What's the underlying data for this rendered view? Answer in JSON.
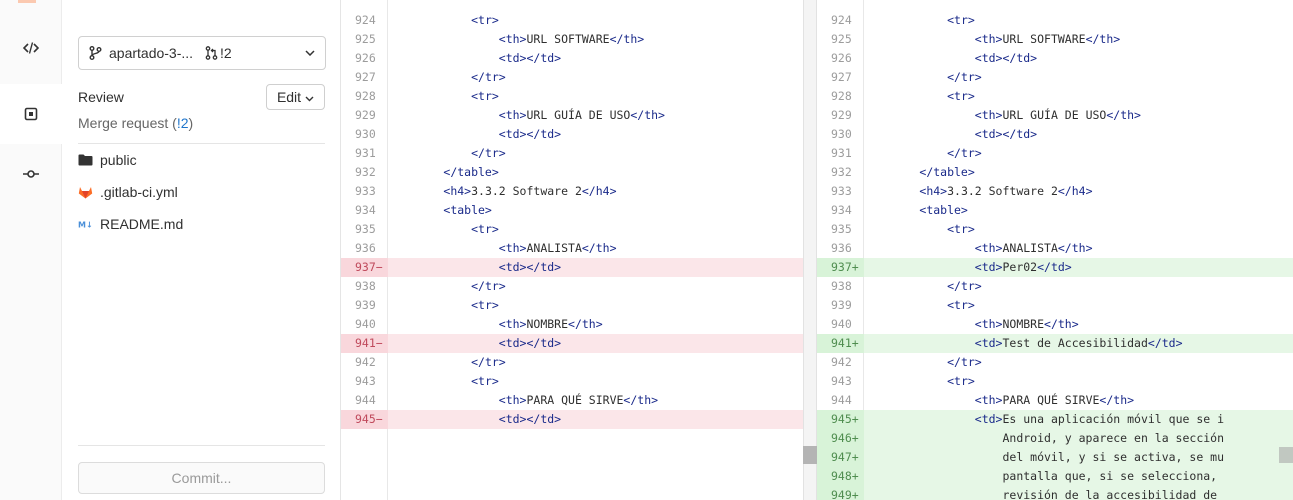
{
  "activity_bar": {
    "items": [
      {
        "icon": "code-icon",
        "active": false
      },
      {
        "icon": "review-icon",
        "active": true
      },
      {
        "icon": "commit-icon",
        "active": false
      }
    ]
  },
  "sidebar": {
    "branch_name": "apartado-3-...",
    "merge_request_badge": "!2",
    "review_title": "Review",
    "edit_label": "Edit",
    "mr_text_prefix": "Merge request (",
    "mr_number": "!2",
    "mr_text_suffix": ")",
    "files": [
      {
        "name": "public",
        "icon": "folder-icon"
      },
      {
        "name": ".gitlab-ci.yml",
        "icon": "gitlab-icon"
      },
      {
        "name": "README.md",
        "icon": "markdown-icon"
      }
    ],
    "commit_label": "Commit..."
  },
  "diff": {
    "left": [
      {
        "n": "924",
        "type": "ctx",
        "code": "            <tr>"
      },
      {
        "n": "925",
        "type": "ctx",
        "code": "                <th>URL SOFTWARE</th>"
      },
      {
        "n": "926",
        "type": "ctx",
        "code": "                <td></td>"
      },
      {
        "n": "927",
        "type": "ctx",
        "code": "            </tr>"
      },
      {
        "n": "928",
        "type": "ctx",
        "code": "            <tr>"
      },
      {
        "n": "929",
        "type": "ctx",
        "code": "                <th>URL GUÍA DE USO</th>"
      },
      {
        "n": "930",
        "type": "ctx",
        "code": "                <td></td>"
      },
      {
        "n": "931",
        "type": "ctx",
        "code": "            </tr>"
      },
      {
        "n": "932",
        "type": "ctx",
        "code": "        </table>"
      },
      {
        "n": "933",
        "type": "ctx",
        "code": "        <h4>3.3.2 Software 2</h4>"
      },
      {
        "n": "934",
        "type": "ctx",
        "code": "        <table>"
      },
      {
        "n": "935",
        "type": "ctx",
        "code": "            <tr>"
      },
      {
        "n": "936",
        "type": "ctx",
        "code": "                <th>ANALISTA</th>"
      },
      {
        "n": "937−",
        "type": "del",
        "code": "                <td></td>"
      },
      {
        "n": "938",
        "type": "ctx",
        "code": "            </tr>"
      },
      {
        "n": "939",
        "type": "ctx",
        "code": "            <tr>"
      },
      {
        "n": "940",
        "type": "ctx",
        "code": "                <th>NOMBRE</th>"
      },
      {
        "n": "941−",
        "type": "del",
        "code": "                <td></td>"
      },
      {
        "n": "942",
        "type": "ctx",
        "code": "            </tr>"
      },
      {
        "n": "943",
        "type": "ctx",
        "code": "            <tr>"
      },
      {
        "n": "944",
        "type": "ctx",
        "code": "                <th>PARA QUÉ SIRVE</th>"
      },
      {
        "n": "945−",
        "type": "del",
        "code": "                <td></td>"
      }
    ],
    "right": [
      {
        "n": "924",
        "type": "ctx",
        "code": "            <tr>"
      },
      {
        "n": "925",
        "type": "ctx",
        "code": "                <th>URL SOFTWARE</th>"
      },
      {
        "n": "926",
        "type": "ctx",
        "code": "                <td></td>"
      },
      {
        "n": "927",
        "type": "ctx",
        "code": "            </tr>"
      },
      {
        "n": "928",
        "type": "ctx",
        "code": "            <tr>"
      },
      {
        "n": "929",
        "type": "ctx",
        "code": "                <th>URL GUÍA DE USO</th>"
      },
      {
        "n": "930",
        "type": "ctx",
        "code": "                <td></td>"
      },
      {
        "n": "931",
        "type": "ctx",
        "code": "            </tr>"
      },
      {
        "n": "932",
        "type": "ctx",
        "code": "        </table>"
      },
      {
        "n": "933",
        "type": "ctx",
        "code": "        <h4>3.3.2 Software 2</h4>"
      },
      {
        "n": "934",
        "type": "ctx",
        "code": "        <table>"
      },
      {
        "n": "935",
        "type": "ctx",
        "code": "            <tr>"
      },
      {
        "n": "936",
        "type": "ctx",
        "code": "                <th>ANALISTA</th>"
      },
      {
        "n": "937+",
        "type": "add",
        "code": "                <td>Per02</td>"
      },
      {
        "n": "938",
        "type": "ctx",
        "code": "            </tr>"
      },
      {
        "n": "939",
        "type": "ctx",
        "code": "            <tr>"
      },
      {
        "n": "940",
        "type": "ctx",
        "code": "                <th>NOMBRE</th>"
      },
      {
        "n": "941+",
        "type": "add",
        "code": "                <td>Test de Accesibilidad</td>"
      },
      {
        "n": "942",
        "type": "ctx",
        "code": "            </tr>"
      },
      {
        "n": "943",
        "type": "ctx",
        "code": "            <tr>"
      },
      {
        "n": "944",
        "type": "ctx",
        "code": "                <th>PARA QUÉ SIRVE</th>"
      },
      {
        "n": "945+",
        "type": "add",
        "code": "                <td>Es una aplicación móvil que se i"
      },
      {
        "n": "946+",
        "type": "add",
        "code": "                    Android, y aparece en la sección"
      },
      {
        "n": "947+",
        "type": "add",
        "code": "                    del móvil, y si se activa, se mu"
      },
      {
        "n": "948+",
        "type": "add",
        "code": "                    pantalla que, si se selecciona,"
      },
      {
        "n": "949+",
        "type": "add",
        "code": "                    revisión de la accesibilidad de"
      }
    ]
  },
  "colors": {
    "deleted_line": "#fbe6e9",
    "added_line": "#e6f7e6",
    "tag": "#1a2a8a",
    "link": "#1f75cb"
  }
}
